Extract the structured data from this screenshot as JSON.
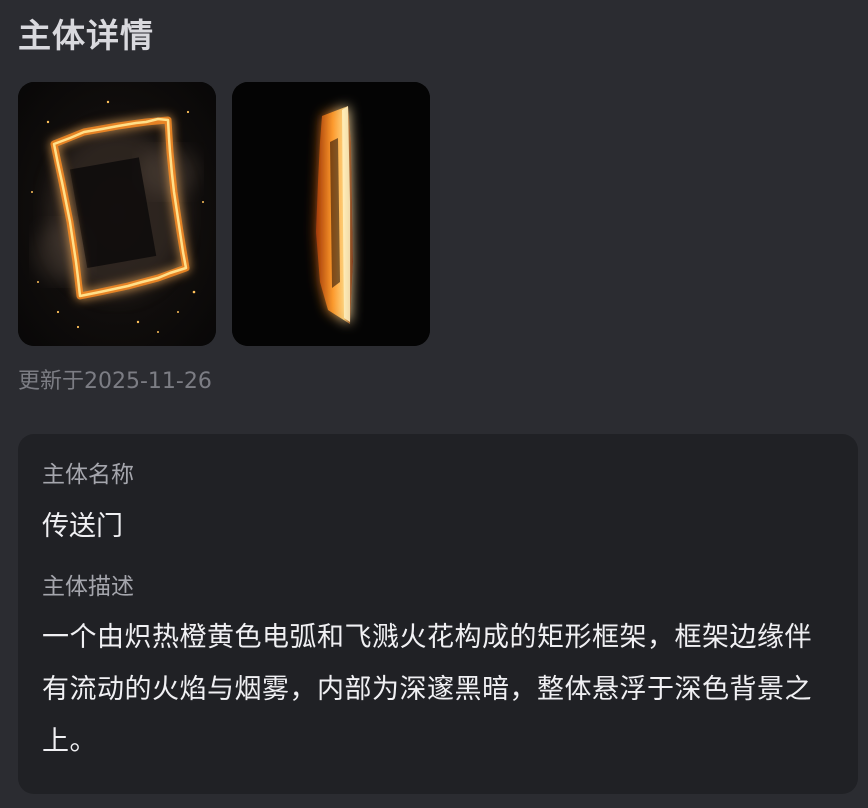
{
  "header": {
    "title": "主体详情"
  },
  "gallery": {
    "images": [
      {
        "alt": "portal-front",
        "icon": "fiery-portal-front-image"
      },
      {
        "alt": "portal-side",
        "icon": "fiery-portal-side-image"
      }
    ]
  },
  "meta": {
    "updated_text": "更新于2025-11-26"
  },
  "details": {
    "name_label": "主体名称",
    "name_value": "传送门",
    "desc_label": "主体描述",
    "desc_value": "一个由炽热橙黄色电弧和飞溅火花构成的矩形框架，框架边缘伴有流动的火焰与烟雾，内部为深邃黑暗，整体悬浮于深色背景之上。"
  },
  "colors": {
    "background": "#2b2c31",
    "card": "#202125",
    "fire": "#ff9a1f"
  }
}
